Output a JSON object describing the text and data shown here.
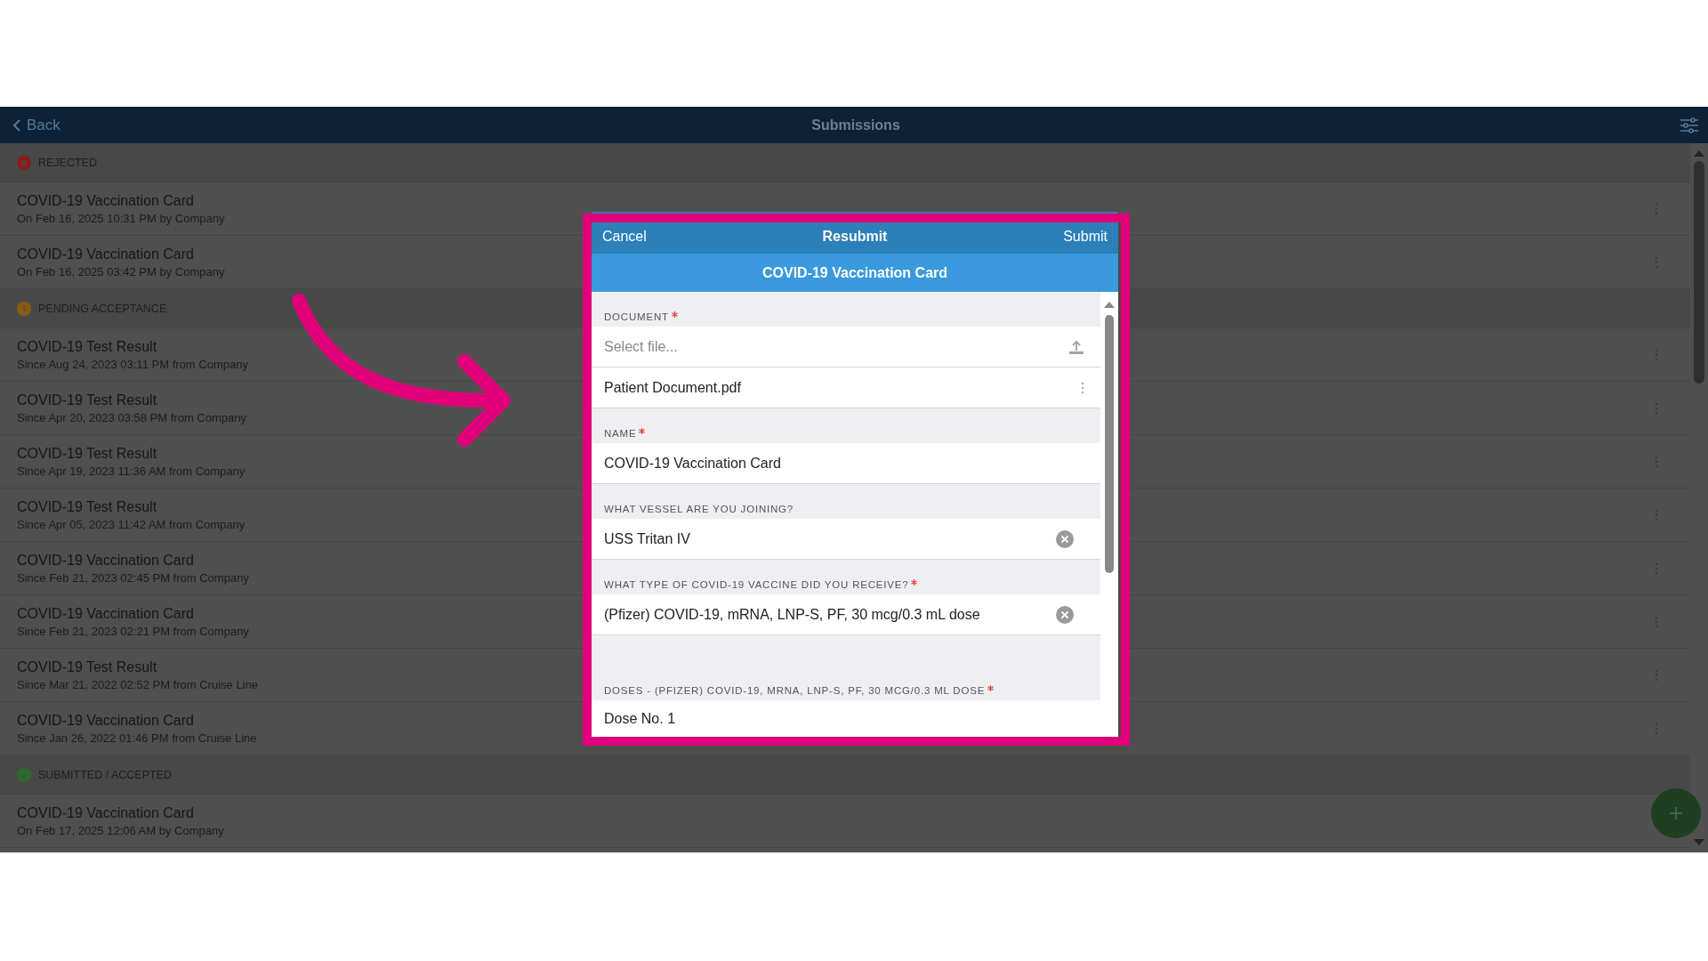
{
  "header": {
    "back": "Back",
    "title": "Submissions"
  },
  "sections": [
    {
      "kind": "rejected",
      "title": "REJECTED",
      "items": [
        {
          "title": "COVID-19 Vaccination Card",
          "subtitle": "On Feb 16, 2025 10:31 PM by Company"
        },
        {
          "title": "COVID-19 Vaccination Card",
          "subtitle": "On Feb 16, 2025 03:42 PM by Company"
        }
      ]
    },
    {
      "kind": "pending",
      "title": "PENDING ACCEPTANCE",
      "items": [
        {
          "title": "COVID-19 Test Result",
          "subtitle": "Since Aug 24, 2023 03:11 PM from Company"
        },
        {
          "title": "COVID-19 Test Result",
          "subtitle": "Since Apr 20, 2023 03:58 PM from Company"
        },
        {
          "title": "COVID-19 Test Result",
          "subtitle": "Since Apr 19, 2023 11:36 AM from Company"
        },
        {
          "title": "COVID-19 Test Result",
          "subtitle": "Since Apr 05, 2023 11:42 AM from Company"
        },
        {
          "title": "COVID-19 Vaccination Card",
          "subtitle": "Since Feb 21, 2023 02:45 PM from Company"
        },
        {
          "title": "COVID-19 Vaccination Card",
          "subtitle": "Since Feb 21, 2023 02:21 PM from Company"
        },
        {
          "title": "COVID-19 Test Result",
          "subtitle": "Since Mar 21, 2022 02:52 PM from Cruise Line"
        },
        {
          "title": "COVID-19 Vaccination Card",
          "subtitle": "Since Jan 26, 2022 01:46 PM from Cruise Line"
        }
      ]
    },
    {
      "kind": "accepted",
      "title": "SUBMITTED / ACCEPTED",
      "items": [
        {
          "title": "COVID-19 Vaccination Card",
          "subtitle": "On Feb 17, 2025 12:06 AM by Company"
        }
      ]
    }
  ],
  "dialog": {
    "cancel": "Cancel",
    "title": "Resubmit",
    "submit": "Submit",
    "form_title": "COVID-19 Vaccination Card",
    "fields": [
      {
        "kind": "file",
        "label": "DOCUMENT",
        "required": true,
        "placeholder": "Select file...",
        "files": [
          "Patient Document.pdf"
        ]
      },
      {
        "kind": "text",
        "label": "NAME",
        "required": true,
        "value": "COVID-19 Vaccination Card"
      },
      {
        "kind": "select",
        "label": "WHAT VESSEL ARE YOU JOINING?",
        "value": "USS Tritan IV"
      },
      {
        "kind": "select",
        "label": "WHAT TYPE OF COVID-19 VACCINE DID YOU RECEIVE?",
        "required": true,
        "value": "(Pfizer) COVID-19, mRNA, LNP-S, PF, 30 mcg/0.3 mL dose"
      },
      {
        "kind": "list",
        "label": "DOSES - (PFIZER) COVID-19, MRNA, LNP-S, PF, 30 MCG/0.3 ML DOSE",
        "required": true,
        "value": "Dose No. 1"
      }
    ]
  }
}
